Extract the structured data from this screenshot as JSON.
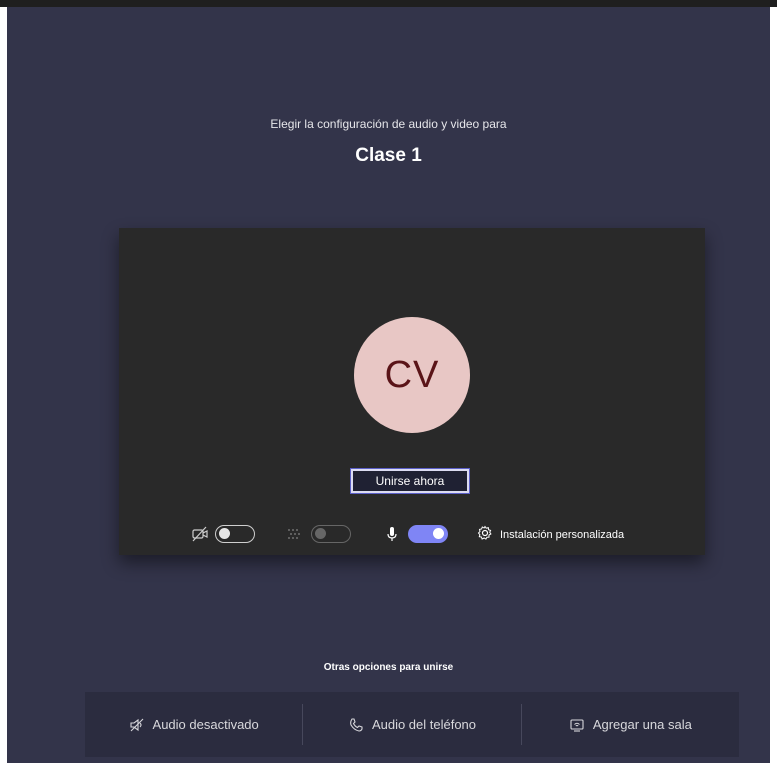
{
  "prejoin": {
    "subtitle": "Elegir la configuración de audio y video para",
    "meeting_title": "Clase 1"
  },
  "preview": {
    "avatar_initials": "CV",
    "join_button_label": "Unirse ahora",
    "controls": {
      "camera": {
        "icon": "video-off-icon",
        "state": "off"
      },
      "background_blur": {
        "icon": "blur-icon",
        "state": "disabled"
      },
      "microphone": {
        "icon": "microphone-icon",
        "state": "on"
      },
      "custom_setup_label": "Instalación personalizada"
    }
  },
  "other_options": {
    "title": "Otras opciones para unirse",
    "items": [
      {
        "label": "Audio desactivado",
        "icon": "speaker-off-icon"
      },
      {
        "label": "Audio del teléfono",
        "icon": "phone-icon"
      },
      {
        "label": "Agregar una sala",
        "icon": "cast-room-icon"
      }
    ]
  },
  "colors": {
    "background": "#33344a",
    "preview_background": "#292929",
    "accent": "#7f85f5",
    "avatar_background": "#e8c7c5",
    "avatar_text": "#5a1418"
  }
}
